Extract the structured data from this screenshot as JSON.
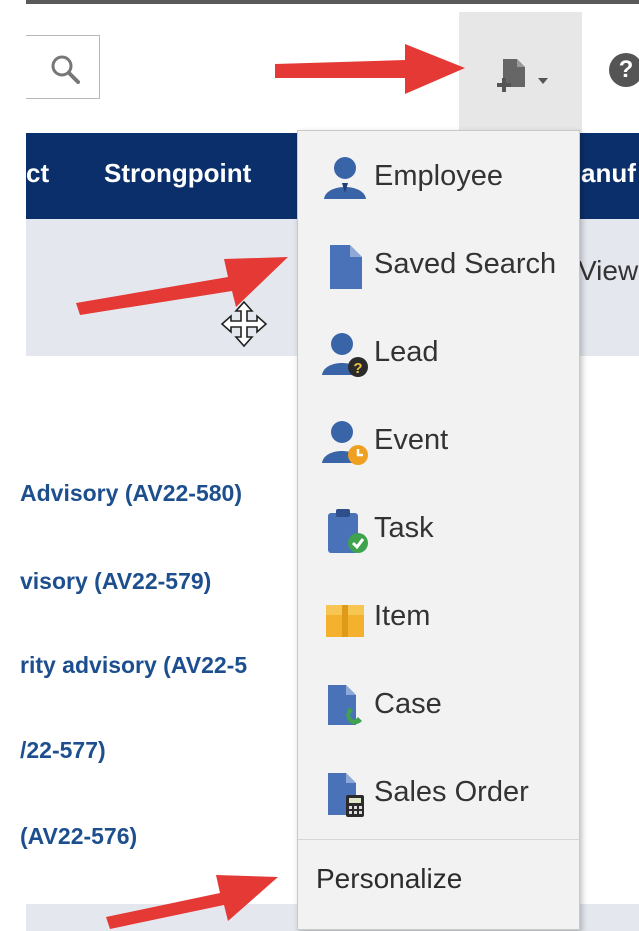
{
  "colors": {
    "nav_bg": "#0a2f6b",
    "link": "#1d4f8f",
    "arrow": "#e53935",
    "icon_blue": "#3a64a8"
  },
  "header": {
    "search_icon": "search-icon",
    "create_icon": "new-record-icon",
    "help_glyph": "?"
  },
  "navbar": {
    "items": [
      "ct",
      "Strongpoint",
      "anuf"
    ]
  },
  "subbar": {
    "view_text": "View"
  },
  "links": [
    "Advisory (AV22-580)",
    "visory (AV22-579)",
    "rity advisory (AV22-5",
    "/22-577)",
    "(AV22-576)"
  ],
  "menu": {
    "items": [
      {
        "label": "Employee",
        "icon": "employee-icon"
      },
      {
        "label": "Saved Search",
        "icon": "saved-search-icon"
      },
      {
        "label": "Lead",
        "icon": "lead-icon"
      },
      {
        "label": "Event",
        "icon": "event-icon"
      },
      {
        "label": "Task",
        "icon": "task-icon"
      },
      {
        "label": "Item",
        "icon": "item-icon"
      },
      {
        "label": "Case",
        "icon": "case-icon"
      },
      {
        "label": "Sales Order",
        "icon": "sales-order-icon"
      }
    ],
    "personalize": "Personalize"
  }
}
